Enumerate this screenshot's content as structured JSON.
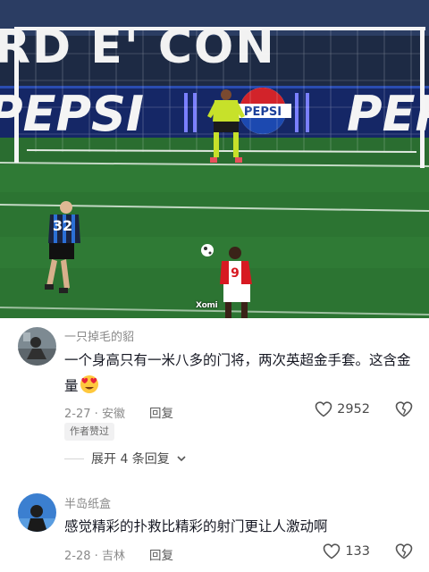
{
  "video": {
    "banner_text": "RD E' CON",
    "ad_text": "PEPSI",
    "ad_logo_text": "PEPSI",
    "player_left_number": "32",
    "player_right_number": "9",
    "watermark": "Xomi"
  },
  "comments": [
    {
      "username": "一只掉毛的貂",
      "text": "一个身高只有一米八多的门将，两次英超金手套。这含金量",
      "emoji": "heart-eyes-emoji",
      "date": "2-27",
      "location": "安徽",
      "reply_label": "回复",
      "likes": "2952",
      "badge": "作者赞过",
      "expand_label": "展开 4 条回复"
    },
    {
      "username": "半岛纸盒",
      "text": "感觉精彩的扑救比精彩的射门更让人激动啊",
      "date": "2-28",
      "location": "吉林",
      "reply_label": "回复",
      "likes": "133"
    }
  ],
  "colors": {
    "pitch": "#2f7a35",
    "text_primary": "#161823",
    "text_secondary": "#8a8a8a"
  }
}
